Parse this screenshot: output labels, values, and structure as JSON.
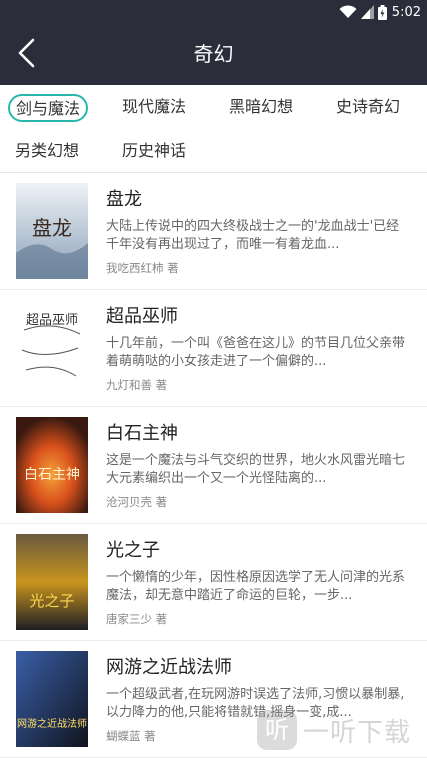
{
  "status_bar": {
    "time": "5:02"
  },
  "nav": {
    "title": "奇幻"
  },
  "tags": [
    {
      "label": "剑与魔法",
      "active": true
    },
    {
      "label": "现代魔法",
      "active": false
    },
    {
      "label": "黑暗幻想",
      "active": false
    },
    {
      "label": "史诗奇幻",
      "active": false
    },
    {
      "label": "另类幻想",
      "active": false
    },
    {
      "label": "历史神话",
      "active": false
    }
  ],
  "books": [
    {
      "title": "盘龙",
      "description": "大陆上传说中的四大终极战士之一的'龙血战士'已经千年没有再出现过了，而唯一有着龙血...",
      "author": "我吃西红柿 著",
      "cover_text": "盘龙",
      "cover_colors": [
        "#dfe6ee",
        "#8aa0b8"
      ]
    },
    {
      "title": "超品巫师",
      "description": "十几年前，一个叫《爸爸在这儿》的节目几位父亲带着萌萌哒的小女孩走进了一个偏僻的...",
      "author": "九灯和善 著",
      "cover_text": "超品巫师",
      "cover_colors": [
        "#ffffff",
        "#cfcfcf"
      ]
    },
    {
      "title": "白石主神",
      "description": "这是一个魔法与斗气交织的世界，地火水风雷光暗七大元素编织出一个又一个光怪陆离的...",
      "author": "沧河贝壳 著",
      "cover_text": "白石主神",
      "cover_colors": [
        "#3a1a10",
        "#d8501c"
      ]
    },
    {
      "title": "光之子",
      "description": "一个懒惰的少年，因性格原因选学了无人问津的光系魔法，却无意中踏近了命运的巨轮，一步...",
      "author": "唐家三少 著",
      "cover_text": "光之子",
      "cover_colors": [
        "#1e1e24",
        "#c8941e"
      ]
    },
    {
      "title": "网游之近战法师",
      "description": "一个超级武者,在玩网游时误选了法师,习惯以暴制暴,以力降力的他,只能将错就错,摇身一变,成...",
      "author": "蝴蝶蓝 著",
      "cover_text": "网游之近战法师",
      "cover_colors": [
        "#10141e",
        "#3a5fa8"
      ]
    }
  ],
  "watermark": {
    "logo": "听",
    "text": "一听下载"
  },
  "icons": {
    "back": "chevron-left-icon",
    "wifi": "wifi-icon",
    "signal": "signal-icon",
    "battery": "battery-icon"
  },
  "colors": {
    "nav_bg": "#2b2e3a",
    "accent": "#28b9ae"
  }
}
